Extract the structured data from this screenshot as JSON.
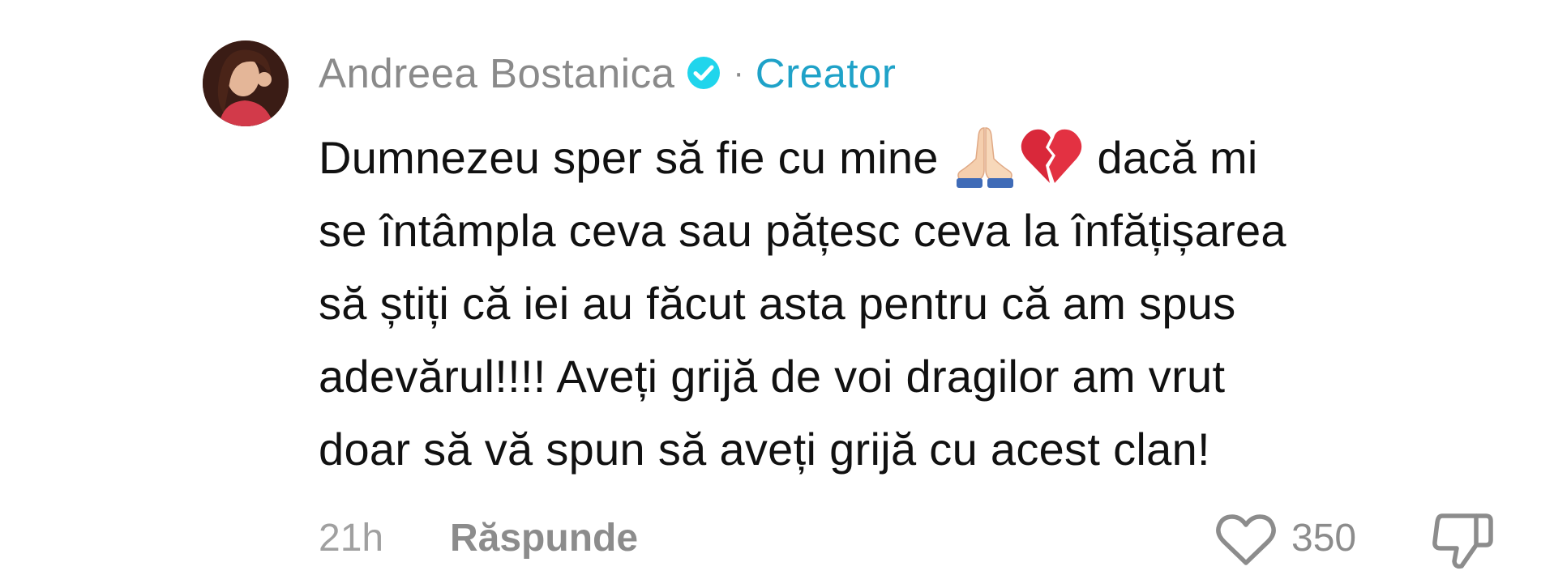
{
  "comment": {
    "author": "Andreea Bostanica",
    "verified": true,
    "separator": "·",
    "author_badge": "Creator",
    "text_lines": [
      {
        "before": "Dumnezeu sper să fie cu mine ",
        "emojis": [
          "folded-hands-emoji",
          "broken-heart-emoji"
        ],
        "after": " dacă mi"
      },
      {
        "text": "se întâmpla ceva sau pățesc ceva la înfățișarea"
      },
      {
        "text": "să știți că iei au făcut asta pentru că am spus"
      },
      {
        "text": "adevărul!!!! Aveți grijă de voi dragilor am vrut"
      },
      {
        "text": "doar să vă spun să aveți grijă cu acest clan!"
      }
    ],
    "time": "21h",
    "reply_label": "Răspunde",
    "like_count": "350"
  },
  "icons": {
    "verified": "verified-check-icon",
    "like": "heart-outline-icon",
    "dislike": "thumbs-down-icon"
  },
  "colors": {
    "username": "#8a8a8a",
    "creator_badge": "#1fa2c8",
    "verified_badge": "#20d5ec",
    "text": "#111111",
    "meta": "#8c8c8c"
  }
}
